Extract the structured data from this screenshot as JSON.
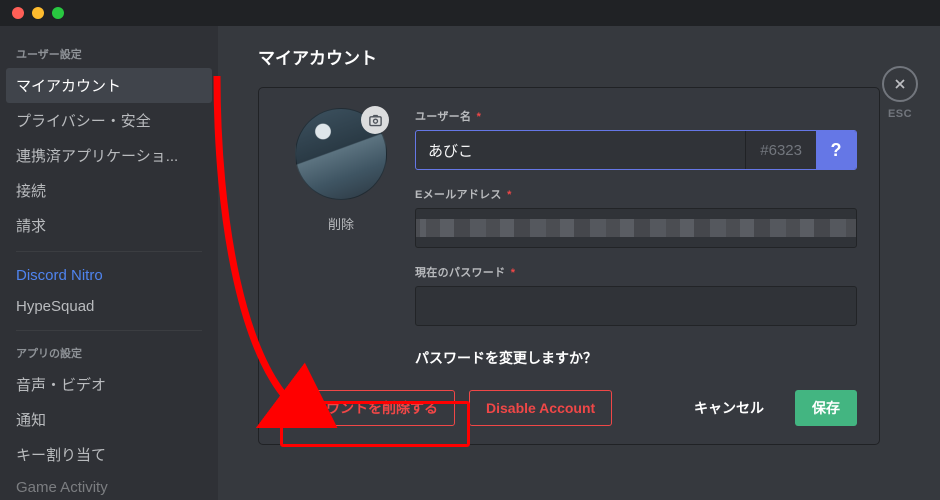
{
  "sidebar": {
    "headings": {
      "user": "ユーザー設定",
      "app": "アプリの設定"
    },
    "items": [
      {
        "label": "マイアカウント",
        "active": true
      },
      {
        "label": "プライバシー・安全"
      },
      {
        "label": "連携済アプリケーショ..."
      },
      {
        "label": "接続"
      },
      {
        "label": "請求"
      }
    ],
    "nitro_label": "Discord Nitro",
    "hypesquad_label": "HypeSquad",
    "app_items": [
      {
        "label": "音声・ビデオ"
      },
      {
        "label": "通知"
      },
      {
        "label": "キー割り当て"
      },
      {
        "label": "Game Activity"
      }
    ]
  },
  "page": {
    "title": "マイアカウント",
    "esc_label": "ESC"
  },
  "avatar": {
    "remove_label": "削除"
  },
  "form": {
    "username_label": "ユーザー名",
    "username_value": "あびこ",
    "discriminator": "#6323",
    "help_label": "?",
    "email_label": "Eメールアドレス",
    "password_label": "現在のパスワード",
    "password_change_question": "パスワードを変更しますか？"
  },
  "buttons": {
    "delete_account": "アカウントを削除する",
    "disable_account": "Disable Account",
    "cancel": "キャンセル",
    "save": "保存"
  }
}
